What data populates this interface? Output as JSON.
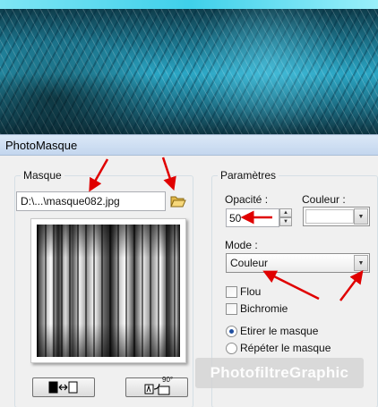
{
  "window": {
    "title": "PhotoMasque"
  },
  "masque": {
    "legend": "Masque",
    "file_path": "D:\\...\\masque082.jpg",
    "open_icon": "folder-open-icon",
    "invert_icon": "invert-mask-icon",
    "rotate_icon": "rotate-90-icon",
    "rotate_label": "90°"
  },
  "parametres": {
    "legend": "Paramètres",
    "opacite_label": "Opacité :",
    "opacite_value": "50",
    "couleur_label": "Couleur :",
    "couleur_value": "#ffffff",
    "mode_label": "Mode :",
    "mode_value": "Couleur",
    "flou_label": "Flou",
    "flou_checked": false,
    "bichromie_label": "Bichromie",
    "bichromie_checked": false,
    "etirer_label": "Etirer le masque",
    "etirer_selected": true,
    "repeter_label": "Répéter le masque",
    "repeter_selected": false
  },
  "watermark": {
    "text": "PhotofiltreGraphic"
  },
  "colors": {
    "annotation_arrow": "#e00000",
    "titlebar": "#c9daf0",
    "banner": "#2ba6c4"
  }
}
